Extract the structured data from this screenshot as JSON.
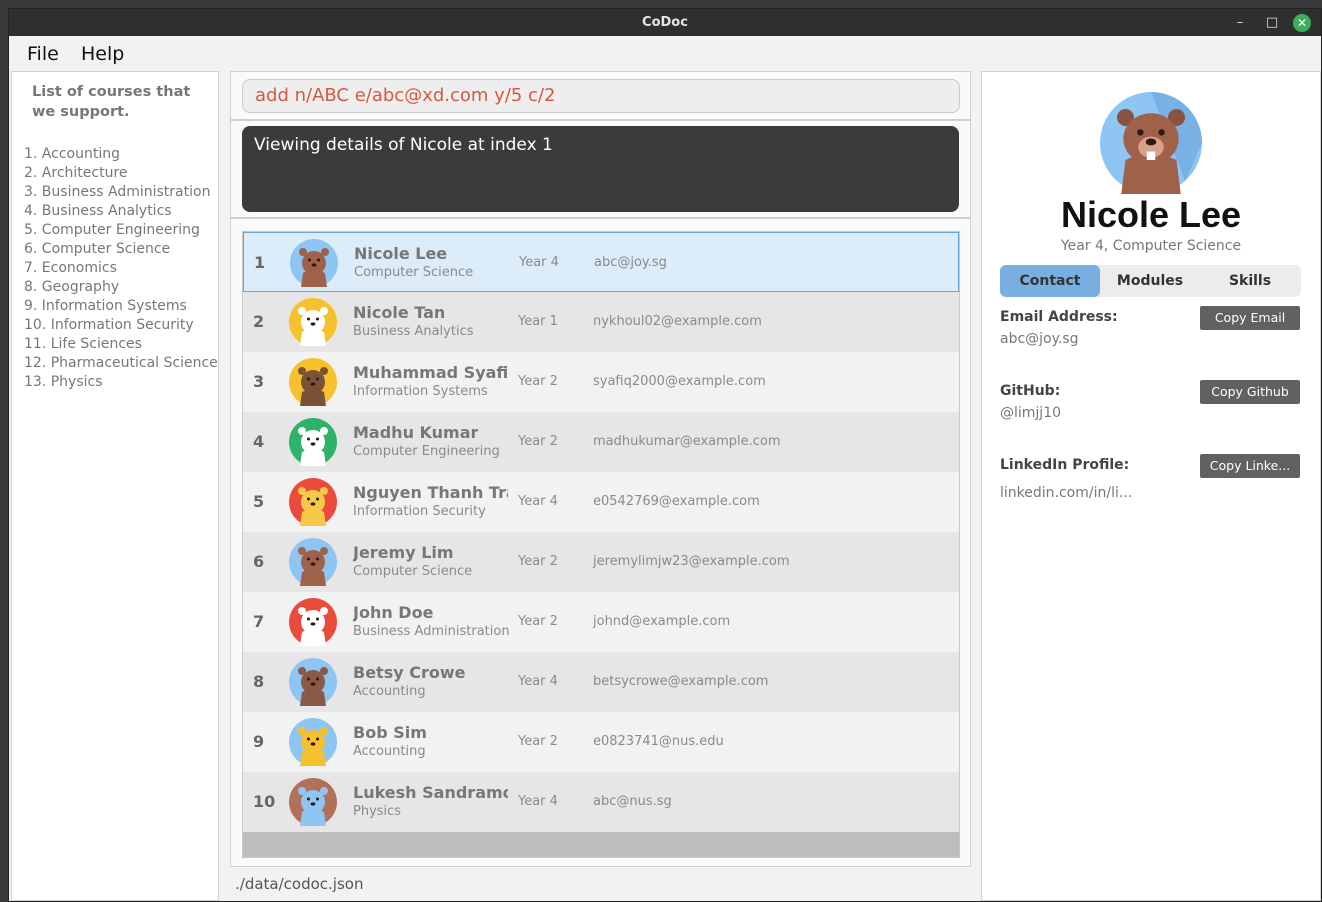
{
  "window": {
    "title": "CoDoc"
  },
  "menu": {
    "file": "File",
    "help": "Help"
  },
  "courses": {
    "title": "List of courses that we support.",
    "items": [
      "1. Accounting",
      "2. Architecture",
      "3. Business Administration",
      "4. Business Analytics",
      "5. Computer Engineering",
      "6. Computer Science",
      "7. Economics",
      "8. Geography",
      "9. Information Systems",
      "10. Information Security",
      "11. Life Sciences",
      "12. Pharmaceutical Science",
      "13. Physics"
    ]
  },
  "command": {
    "value": "add n/ABC e/abc@xd.com y/5 c/2"
  },
  "result": {
    "text": "Viewing details of Nicole at index 1"
  },
  "people": [
    {
      "index": "1",
      "name": "Nicole Lee",
      "course": "Computer Science",
      "year": "Year 4",
      "email": "abc@joy.sg",
      "avatar": "beaver-avatar",
      "bg": "#8ec5f2",
      "fg": "#a0614a",
      "selected": true
    },
    {
      "index": "2",
      "name": "Nicole Tan",
      "course": "Business Analytics",
      "year": "Year 1",
      "email": "nykhoul02@example.com",
      "avatar": "panda-avatar",
      "bg": "#f5c12e",
      "fg": "#ffffff"
    },
    {
      "index": "3",
      "name": "Muhammad Syafiq",
      "course": "Information Systems",
      "year": "Year 2",
      "email": "syafiq2000@example.com",
      "avatar": "sloth-avatar",
      "bg": "#f5c12e",
      "fg": "#7a5235"
    },
    {
      "index": "4",
      "name": "Madhu Kumar",
      "course": "Computer Engineering",
      "year": "Year 2",
      "email": "madhukumar@example.com",
      "avatar": "chicken-avatar",
      "bg": "#2fb36a",
      "fg": "#ffffff"
    },
    {
      "index": "5",
      "name": "Nguyen Thanh Tran",
      "course": "Information Security",
      "year": "Year 4",
      "email": "e0542769@example.com",
      "avatar": "pufferfish-avatar",
      "bg": "#ea4b3b",
      "fg": "#f7c948"
    },
    {
      "index": "6",
      "name": "Jeremy Lim",
      "course": "Computer Science",
      "year": "Year 2",
      "email": "jeremylimjw23@example.com",
      "avatar": "beaver-avatar",
      "bg": "#8ec5f2",
      "fg": "#a0614a"
    },
    {
      "index": "7",
      "name": "John Doe",
      "course": "Business Administration",
      "year": "Year 2",
      "email": "johnd@example.com",
      "avatar": "duck-avatar",
      "bg": "#ea4b3b",
      "fg": "#ffffff"
    },
    {
      "index": "8",
      "name": "Betsy Crowe",
      "course": "Accounting",
      "year": "Year 4",
      "email": "betsycrowe@example.com",
      "avatar": "boar-avatar",
      "bg": "#8ec5f2",
      "fg": "#8a5a44"
    },
    {
      "index": "9",
      "name": "Bob Sim",
      "course": "Accounting",
      "year": "Year 2",
      "email": "e0823741@nus.edu",
      "avatar": "hedgehog-avatar",
      "bg": "#8ec5f2",
      "fg": "#f5c12e"
    },
    {
      "index": "10",
      "name": "Lukesh Sandramor...",
      "course": "Physics",
      "year": "Year 4",
      "email": "abc@nus.sg",
      "avatar": "hippo-avatar",
      "bg": "#b0705a",
      "fg": "#8ec5f2"
    }
  ],
  "status": {
    "path": "./data/codoc.json"
  },
  "detail": {
    "name": "Nicole Lee",
    "subtitle": "Year 4, Computer Science",
    "tabs": {
      "contact": "Contact",
      "modules": "Modules",
      "skills": "Skills"
    },
    "email_label": "Email Address:",
    "email_value": "abc@joy.sg",
    "copy_email": "Copy Email",
    "github_label": "GitHub:",
    "github_value": "@limjj10",
    "copy_github": "Copy Github",
    "linkedin_label": "LinkedIn Profile:",
    "linkedin_value": "linkedin.com/in/li...",
    "copy_linkedin": "Copy Linke..."
  }
}
